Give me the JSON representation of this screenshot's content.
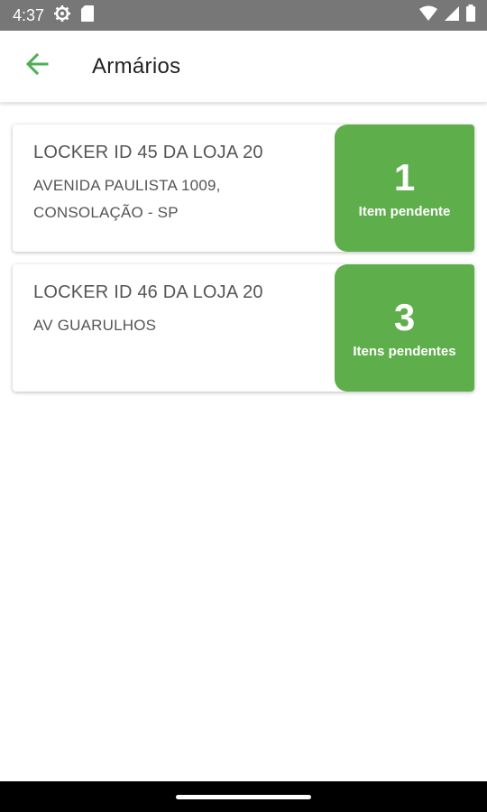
{
  "status_bar": {
    "time": "4:37",
    "icons": [
      "settings-icon",
      "sd-card-icon",
      "wifi-icon",
      "signal-icon",
      "battery-icon"
    ]
  },
  "app_bar": {
    "back_icon": "arrow-back-icon",
    "title": "Armários",
    "accent_color": "#4caf50"
  },
  "lockers": [
    {
      "name": "LOCKER ID 45 DA LOJA 20",
      "address": "AVENIDA PAULISTA 1009, CONSOLAÇÃO - SP",
      "pending_count": "1",
      "pending_label": "Item pendente"
    },
    {
      "name": "LOCKER ID 46 DA LOJA 20",
      "address": "AV GUARULHOS",
      "pending_count": "3",
      "pending_label": "Itens pendentes"
    }
  ],
  "colors": {
    "badge_green": "#5fae4c",
    "status_bar": "#777777"
  }
}
